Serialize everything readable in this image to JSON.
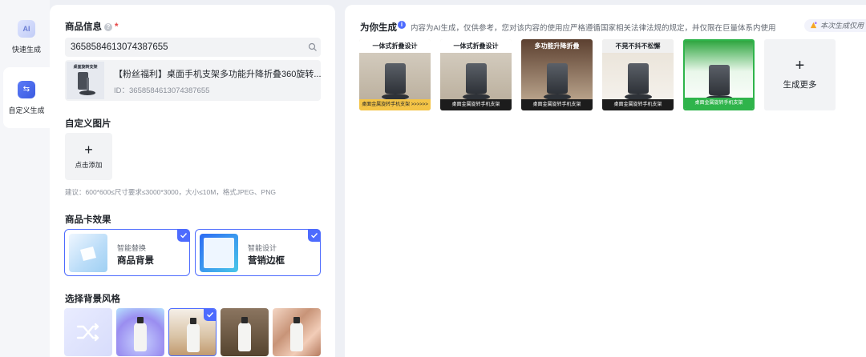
{
  "nav": {
    "items": [
      {
        "label": "快速生成",
        "icon": "ai-icon"
      },
      {
        "label": "自定义生成",
        "icon": "custom-generate-icon"
      }
    ]
  },
  "product_info": {
    "title": "商品信息",
    "required_mark": "*",
    "input_value": "3658584613074387655",
    "product_title": "【粉丝福利】桌面手机支架多功能升降折叠360旋转...",
    "product_id": "ID：3658584613074387655",
    "thumb_caption": "桌面旋转支架"
  },
  "custom_image": {
    "title": "自定义图片",
    "plus": "+",
    "add_label": "点击添加",
    "hint": "建议：600*600≤尺寸要求≤3000*3000，大小≤10M，格式JPEG、PNG"
  },
  "card_effect": {
    "title": "商品卡效果",
    "options": [
      {
        "sub": "智能替换",
        "main": "商品背景",
        "checked": true
      },
      {
        "sub": "智能设计",
        "main": "营销边框",
        "checked": true
      }
    ]
  },
  "bg_style": {
    "title": "选择背景风格",
    "selected_index": 2
  },
  "generate": {
    "title": "为你生成",
    "info_icon": "i",
    "note": "内容为AI生成，仅供参考，您对该内容的使用应严格遵循国家相关法律法规的规定，并仅限在巨量体系内使用",
    "badge": "本次生成仅用",
    "items": [
      {
        "headline": "一体式折叠设计",
        "footer": "桌面金属旋转手机支架 >>>>>>"
      },
      {
        "headline": "一体式折叠设计",
        "footer": "桌面金属旋转手机支架"
      },
      {
        "headline": "多功能升降折叠",
        "footer": "桌面金属旋转手机支架"
      },
      {
        "headline": "不晃不抖不松懈",
        "footer": "桌面金属旋转手机支架"
      },
      {
        "headline": "",
        "footer": "桌面金属旋转手机支架"
      }
    ],
    "more_plus": "+",
    "more_label": "生成更多"
  },
  "colors": {
    "accent": "#4d6bfe",
    "selected_green": "#2fb44b",
    "required": "#e64545"
  }
}
